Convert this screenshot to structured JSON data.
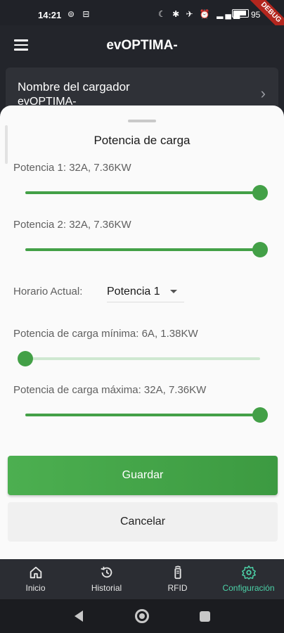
{
  "status_bar": {
    "time": "14:21",
    "left_icons": "⊚ ⊟",
    "right_icons": "☾ ✱ ✈ ⏰ ▂▄▆",
    "battery_text": "95",
    "debug_ribbon": "DEBUG"
  },
  "app_bar": {
    "title": "evOPTIMA-",
    "menu_icon": "hamburger-icon"
  },
  "charger_card": {
    "label": "Nombre del cargador",
    "value": "evOPTIMA-"
  },
  "sheet": {
    "title": "Potencia de carga",
    "sliders": [
      {
        "label": "Potencia 1: 32A, 7.36KW",
        "value_fraction": 1.0
      },
      {
        "label": "Potencia 2: 32A, 7.36KW",
        "value_fraction": 1.0
      },
      {
        "label": "Potencia de carga mínima: 6A, 1.38KW",
        "value_fraction": 0.0
      },
      {
        "label": "Potencia de carga máxima: 32A, 7.36KW",
        "value_fraction": 1.0
      }
    ],
    "horario_label": "Horario Actual:",
    "horario_value": "Potencia 1",
    "save_label": "Guardar",
    "cancel_label": "Cancelar"
  },
  "bottom_nav": [
    {
      "label": "Inicio",
      "icon": "home-icon",
      "active": false
    },
    {
      "label": "Historial",
      "icon": "history-icon",
      "active": false
    },
    {
      "label": "RFID",
      "icon": "rfid-icon",
      "active": false
    },
    {
      "label": "Configuración",
      "icon": "gear-icon",
      "active": true
    }
  ],
  "colors": {
    "accent": "#43a047",
    "active_nav": "#4cd2a8",
    "background": "#23252b"
  }
}
